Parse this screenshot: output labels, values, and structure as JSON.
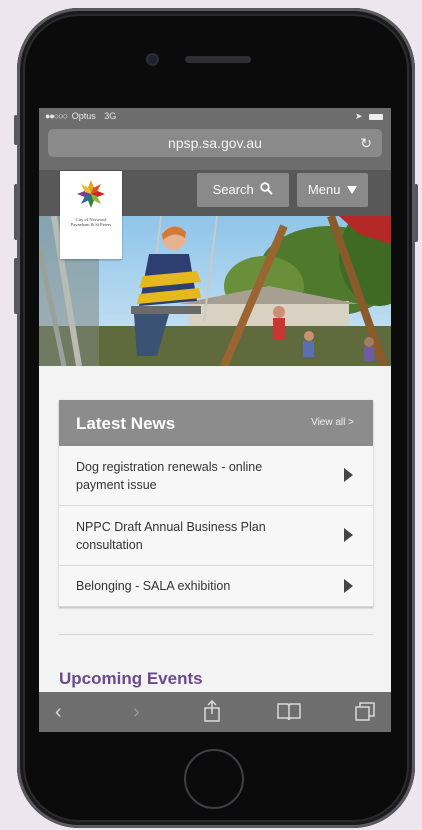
{
  "status_bar": {
    "signal": "●●○○○",
    "carrier": "Optus",
    "network": "3G"
  },
  "browser": {
    "url": "npsp.sa.gov.au",
    "reload_icon": "reload-icon",
    "toolbar_icons": [
      "back-icon",
      "forward-icon",
      "share-icon",
      "bookmarks-icon",
      "tabs-icon"
    ]
  },
  "site": {
    "logo_text": "City of Norwood Payneham & St Peters",
    "search_label": "Search",
    "menu_label": "Menu",
    "header_color": "#585858"
  },
  "latest_news": {
    "title": "Latest News",
    "view_all": "View all >",
    "items": [
      {
        "label": "Dog registration renewals - online payment issue"
      },
      {
        "label": "NPPC Draft Annual Business Plan consultation"
      },
      {
        "label": "Belonging - SALA exhibition"
      }
    ]
  },
  "upcoming_events": {
    "title": "Upcoming Events",
    "color": "#6b4b8c"
  }
}
